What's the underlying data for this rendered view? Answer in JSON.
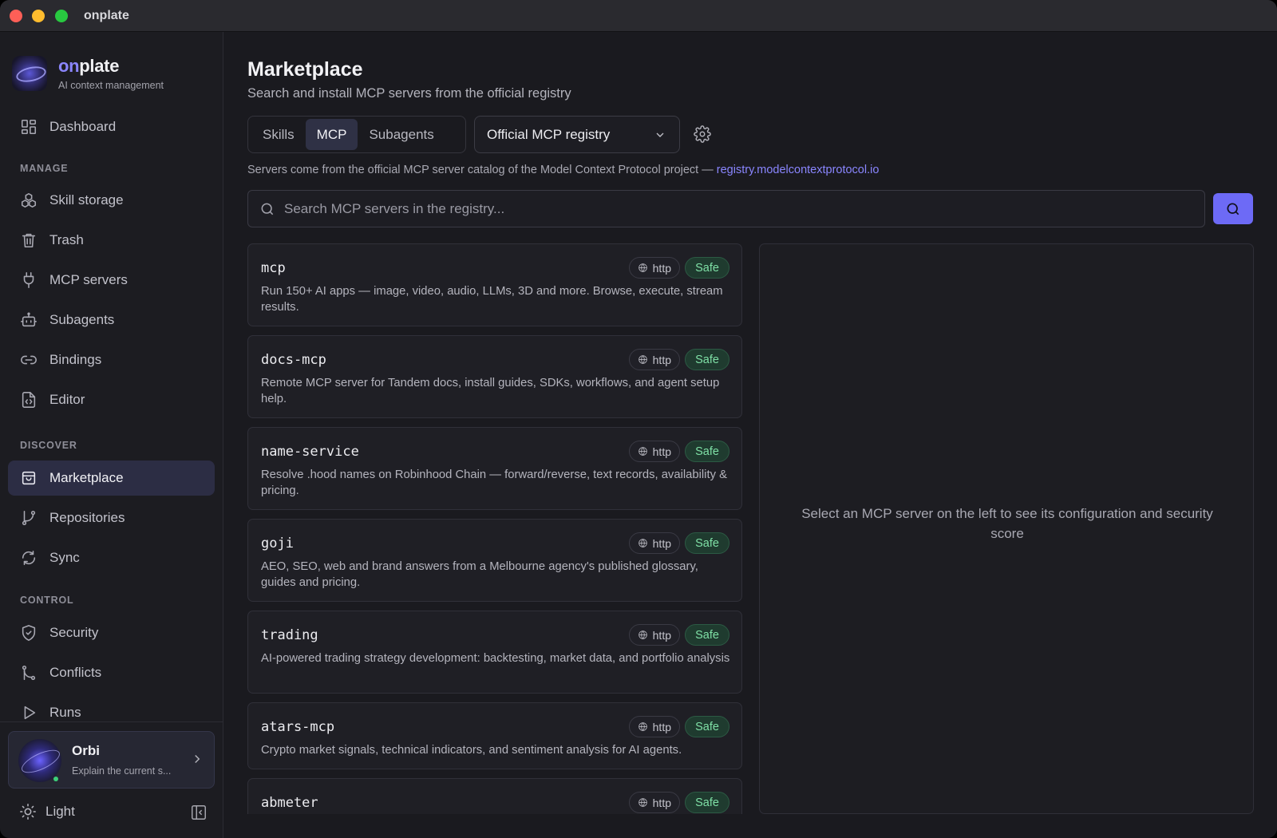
{
  "window": {
    "title": "onplate"
  },
  "brand": {
    "name_prefix": "on",
    "name_suffix": "plate",
    "subtitle": "AI context management"
  },
  "nav": {
    "dashboard": "Dashboard",
    "sections": {
      "manage": "MANAGE",
      "discover": "DISCOVER",
      "control": "CONTROL"
    },
    "items": [
      {
        "label": "Skill storage"
      },
      {
        "label": "Trash"
      },
      {
        "label": "MCP servers"
      },
      {
        "label": "Subagents"
      },
      {
        "label": "Bindings"
      },
      {
        "label": "Editor"
      },
      {
        "label": "Marketplace",
        "active": true
      },
      {
        "label": "Repositories"
      },
      {
        "label": "Sync"
      },
      {
        "label": "Security"
      },
      {
        "label": "Conflicts"
      },
      {
        "label": "Runs"
      }
    ]
  },
  "assistant": {
    "name": "Orbi",
    "subtitle": "Explain the current s..."
  },
  "theme": {
    "label": "Light"
  },
  "page": {
    "title": "Marketplace",
    "subtitle": "Search and install MCP servers from the official registry",
    "tabs": [
      {
        "label": "Skills"
      },
      {
        "label": "MCP",
        "active": true
      },
      {
        "label": "Subagents"
      }
    ],
    "registry_select": {
      "value": "Official MCP registry"
    },
    "info_text": "Servers come from the official MCP server catalog of the Model Context Protocol project — ",
    "info_link": "registry.modelcontextprotocol.io",
    "search": {
      "placeholder": "Search MCP servers in the registry..."
    }
  },
  "servers": [
    {
      "name": "mcp",
      "transport": "http",
      "safety": "Safe",
      "description": "Run 150+ AI apps — image, video, audio, LLMs, 3D and more. Browse, execute, stream results."
    },
    {
      "name": "docs-mcp",
      "transport": "http",
      "safety": "Safe",
      "description": "Remote MCP server for Tandem docs, install guides, SDKs, workflows, and agent setup help."
    },
    {
      "name": "name-service",
      "transport": "http",
      "safety": "Safe",
      "description": "Resolve .hood names on Robinhood Chain — forward/reverse, text records, availability & pricing."
    },
    {
      "name": "goji",
      "transport": "http",
      "safety": "Safe",
      "description": "AEO, SEO, web and brand answers from a Melbourne agency's published glossary, guides and pricing."
    },
    {
      "name": "trading",
      "transport": "http",
      "safety": "Safe",
      "description": "AI-powered trading strategy development: backtesting, market data, and portfolio analysis"
    },
    {
      "name": "atars-mcp",
      "transport": "http",
      "safety": "Safe",
      "description": "Crypto market signals, technical indicators, and sentiment analysis for AI agents."
    },
    {
      "name": "abmeter",
      "transport": "http",
      "safety": "Safe",
      "description": ""
    }
  ],
  "detail": {
    "empty_message": "Select an MCP server on the left to see its configuration and security score"
  },
  "colors": {
    "accent": "#6d6af6",
    "safe_text": "#7fe0a6",
    "safe_bg": "#1f3b2f",
    "active_nav": "#2c2d44"
  }
}
